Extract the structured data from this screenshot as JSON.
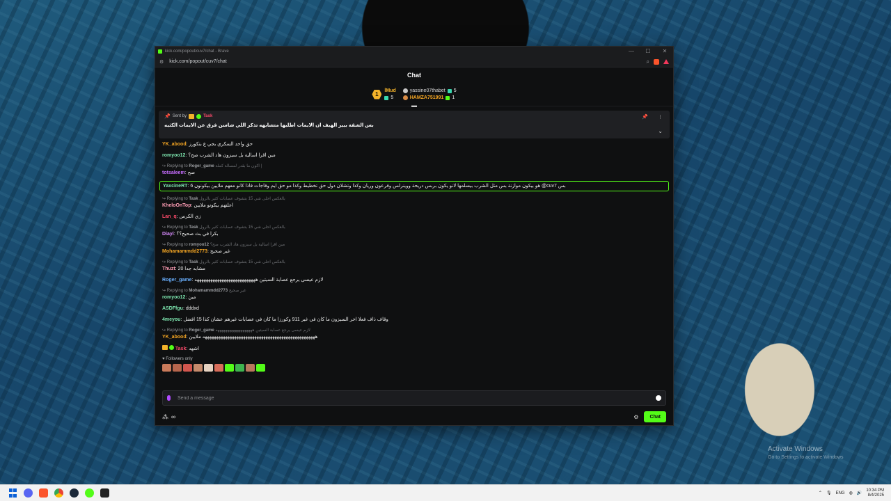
{
  "desktop": {
    "watermark_title": "Activate Windows",
    "watermark_sub": "Go to Settings to activate Windows"
  },
  "browser": {
    "title": "kick.com/popout/cuv7/chat - Brave",
    "url": "kick.com/popout/cuv7/chat",
    "controls": {
      "minimize": "—",
      "maximize": "☐",
      "close": "✕"
    }
  },
  "chat": {
    "header": "Chat",
    "leaderboard": {
      "first": {
        "rank": "1",
        "name": "lMud",
        "gifts": "5"
      },
      "second": {
        "name": "yassine07thabet",
        "gifts": "5"
      },
      "third": {
        "name": "HAMZA751991",
        "gifts": "1"
      }
    },
    "pinned": {
      "sent_by_label": "Sent by",
      "user": "Task",
      "message": "بس الشقة بيير الهيف ان الايمات اطلبها متشابهه تذكر اللي شاسن فرق عن الايمات الكثيه"
    },
    "messages": [
      {
        "user": "YK_abood",
        "color": "#f5a623",
        "text": "حق واحد السكري بجي ع بتكورز"
      },
      {
        "user": "romyoo12",
        "color": "#7ee7b0",
        "text": "مين اقرا اسالية بل سيزون هاد الشرب صح؟"
      },
      {
        "reply_to": "Roger_game",
        "reply_text": "اكون ما بقدر لمسالة كملة |",
        "user": "totsaleem",
        "color": "#c66cff",
        "text": "صح"
      },
      {
        "user": "YaxcineRT",
        "color": "#7ee7b0",
        "text": "هو بيكون موازنة بس مثل الشرب بيسلمها لانو يكون بربس دريحة ووينرلس وفرعون وريان وكذا وتشلان دول حق تخطيط وكذا مو حق ايم وفاجات فاذا كانو معهم ملايين بيكونون 6 @cuv7 بس",
        "highlight": true
      },
      {
        "reply_to": "Task",
        "reply_text": "بالعكس احلى شي 15 بتشوف عصابات كثير بالرول",
        "user": "KheloOnTop",
        "color": "#ff9db5",
        "text": "اعلنهم بيكونو ملايين"
      },
      {
        "user": "Lan_q",
        "color": "#ff4b6b",
        "text": "زي الكرس"
      },
      {
        "reply_to": "Task",
        "reply_text": "بالعكس احلى شي 15 بتشوف عصابات كثير بالرول",
        "user": "Diayi",
        "color": "#d98cff",
        "text": "بكرا في بث صحيح؟؟"
      },
      {
        "reply_to": "romyoo12",
        "reply_text": "مين اقرا اسالية بل سيزون هاد الشرب صح؟",
        "user": "Mohamammdd2773",
        "color": "#f5a623",
        "text": "غير صحيح"
      },
      {
        "reply_to": "Task",
        "reply_text": "بالعكس احلى شي 15 بتشوف عصابات كثير بالرول",
        "user": "Thuzt",
        "color": "#ff9db5",
        "text": "20 مشابه جدا"
      },
      {
        "user": "Roger_game",
        "color": "#6ab0ff",
        "text": "لازم عيسى يرجع عصابة السيتين هههههههههههههههههههههههههههه"
      },
      {
        "reply_to": "Mohamammdd2773",
        "reply_text": "غير صحيح",
        "user": "romyoo12",
        "color": "#7ee7b0",
        "text": "مين"
      },
      {
        "user": "ASDFfgu",
        "color": "#7ee7b0",
        "text": "dddxd"
      },
      {
        "user": "4meyou",
        "color": "#7ee7b0",
        "text": "وقاف ذاف فعلا اخر السيزون ما كان في غير 911 وكورزا ما كان في عصابات غيرهم عشان كذا 15 افضل"
      },
      {
        "reply_to": "Roger_game",
        "reply_text": "لازم عيسى يرجع عصابة السيتين هههههههههههههههههههه",
        "user": "YK_abood",
        "color": "#f5a623",
        "text": "ههههههههههههههههههههههههههههههههههههههههههههههههههه ملايين"
      },
      {
        "user": "Task",
        "color": "#ff4b6b",
        "text": "اشهد",
        "badges": true
      }
    ],
    "followers_only": "Followers only",
    "input_placeholder": "Send a message",
    "send_button": "Chat",
    "points_symbol": "∞"
  },
  "taskbar": {
    "lang": "ENG",
    "time": "10:34 PM",
    "date": "8/4/2025"
  }
}
